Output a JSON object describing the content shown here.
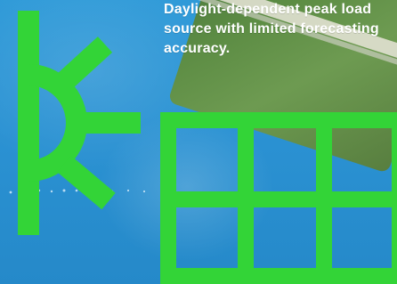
{
  "caption": {
    "text": "Daylight-dependent peak load source with limited forecasting accuracy."
  },
  "colors": {
    "accent_green": "#33d437",
    "text_white": "#ffffff"
  },
  "icons": {
    "sun": "sun-icon",
    "solar_grid": "solar-grid-icon"
  }
}
